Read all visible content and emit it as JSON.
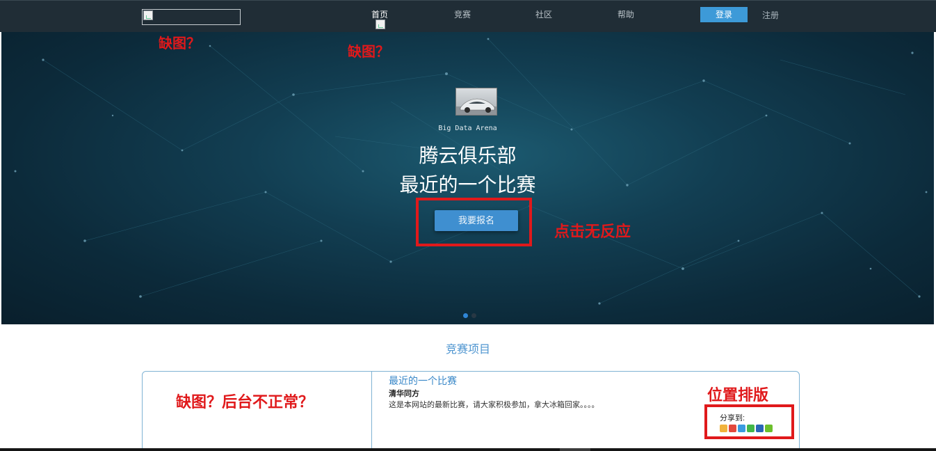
{
  "nav": {
    "items": [
      {
        "label": "首页",
        "active": true
      },
      {
        "label": "竞赛",
        "active": false
      },
      {
        "label": "社区",
        "active": false
      },
      {
        "label": "帮助",
        "active": false
      }
    ],
    "login_label": "登录",
    "register_label": "注册"
  },
  "hero": {
    "subtitle": "Big Data Arena",
    "title_line1": "腾云俱乐部",
    "title_line2": "最近的一个比赛",
    "signup_label": "我要报名",
    "carousel_dots": 2,
    "carousel_active": 1
  },
  "annotations": {
    "logo_missing": "缺图？",
    "nav_missing": "缺图？",
    "no_response": "点击无反应",
    "backend": "缺图？后台不正常？",
    "layout": "位置排版"
  },
  "section": {
    "title": "竞赛项目"
  },
  "competition": {
    "title": "最近的一个比赛",
    "organizer": "清华同方",
    "description": "这是本网站的最新比赛，请大家积极参加，拿大冰箱回家。。。。",
    "share_label": "分享到:",
    "share_icons": [
      "qzone-icon",
      "weibo-icon",
      "tencent-weibo-icon",
      "wechat-icon",
      "renren-icon",
      "more-share-icon"
    ]
  },
  "colors": {
    "nav_bg": "#202d36",
    "accent": "#3d9ad8",
    "annotation_red": "#e0191b",
    "section_title": "#4e95d0"
  }
}
